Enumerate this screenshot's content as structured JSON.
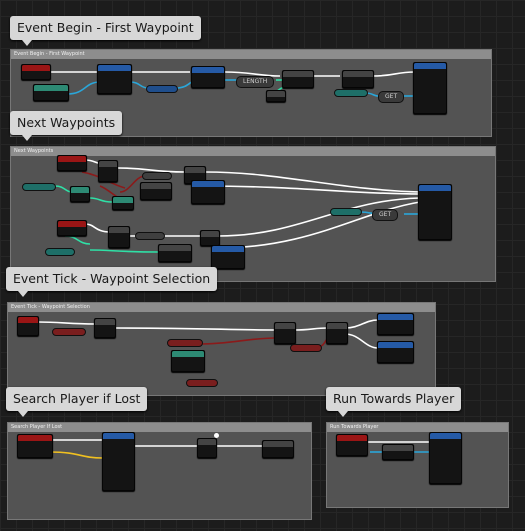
{
  "comments": [
    {
      "title": "Event Begin - First Waypoint",
      "header": "Event Begin - First Waypoint"
    },
    {
      "title": "Next Waypoints",
      "header": "Next Waypoints"
    },
    {
      "title": "Event Tick - Waypoint Selection",
      "header": "Event Tick - Waypoint Selection"
    },
    {
      "title": "Search Player if Lost",
      "header": "Search Player If Lost"
    },
    {
      "title": "Run Towards Player",
      "header": "Run Towards Player"
    }
  ],
  "node_labels": {
    "length": "LENGTH",
    "get1": "GET",
    "get2": "GET"
  },
  "colors": {
    "exec_wire": "#ffffff",
    "object_wire": "#2aa6d9",
    "bool_wire": "#8b1a1a",
    "float_wire": "#9be36e",
    "int_wire": "#2fe0a6",
    "vector_wire": "#f0c020",
    "event_header": "#9a1515",
    "function_header": "#255aa6",
    "pure_header": "#2d8a74"
  }
}
